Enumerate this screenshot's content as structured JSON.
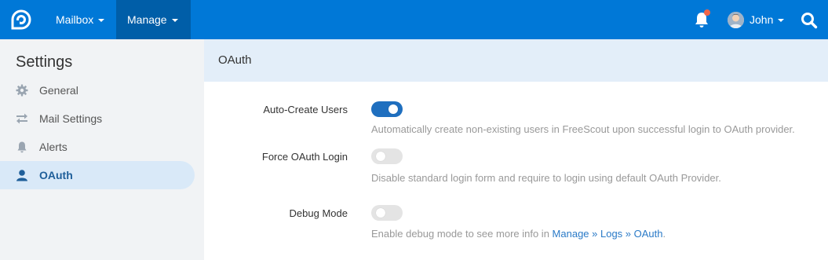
{
  "navbar": {
    "brand_color": "#0078d7",
    "mailbox_label": "Mailbox",
    "manage_label": "Manage",
    "user_name": "John"
  },
  "sidebar": {
    "title": "Settings",
    "items": [
      {
        "label": "General",
        "icon": "gear-icon"
      },
      {
        "label": "Mail Settings",
        "icon": "arrows-icon"
      },
      {
        "label": "Alerts",
        "icon": "bell-icon"
      },
      {
        "label": "OAuth",
        "icon": "user-icon",
        "active": true
      }
    ]
  },
  "main": {
    "title": "OAuth",
    "settings": [
      {
        "label": "Auto-Create Users",
        "enabled": true,
        "help": "Automatically create non-existing users in FreeScout upon successful login to OAuth provider."
      },
      {
        "label": "Force OAuth Login",
        "enabled": false,
        "help": "Disable standard login form and require to login using default OAuth Provider."
      },
      {
        "label": "Debug Mode",
        "enabled": false,
        "help_prefix": "Enable debug mode to see more info in ",
        "help_link": "Manage » Logs » OAuth",
        "help_suffix": "."
      }
    ]
  }
}
